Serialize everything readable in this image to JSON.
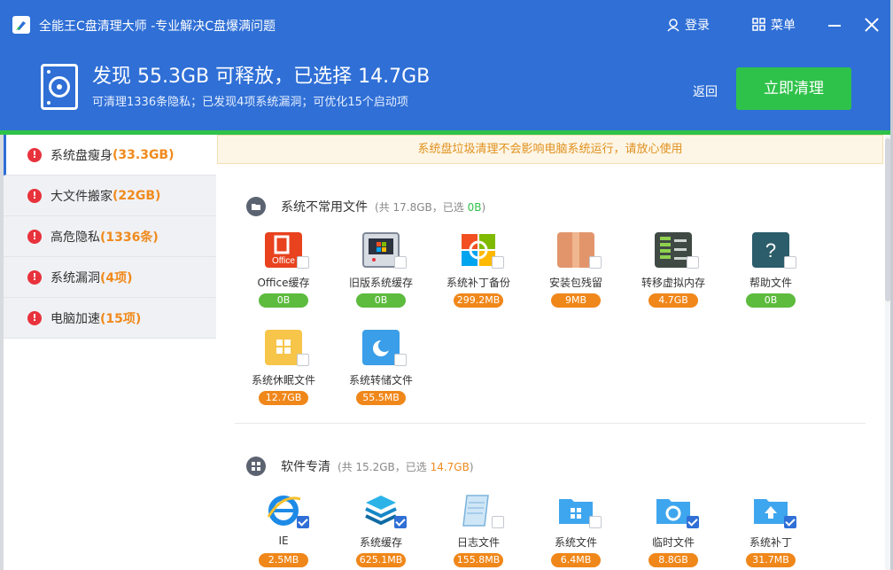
{
  "window": {
    "title": "全能王C盘清理大师 -专业解决C盘爆满问题",
    "login_label": "登录",
    "menu_label": "菜单",
    "icons": {
      "login": "user-icon",
      "menu": "grid-icon",
      "minimize": "minimize-icon",
      "close": "close-icon"
    }
  },
  "summary": {
    "headline": "发现 55.3GB 可释放，已选择 14.7GB",
    "subline": "可清理1336条隐私；已发现4项系统漏洞；可优化15个启动项",
    "back_label": "返回",
    "clean_label": "立即清理"
  },
  "sidebar": {
    "items": [
      {
        "label": "系统盘瘦身",
        "count": "(33.3GB)",
        "active": true
      },
      {
        "label": "大文件搬家",
        "count": "(22GB)",
        "active": false
      },
      {
        "label": "高危隐私",
        "count": "(1336条)",
        "active": false
      },
      {
        "label": "系统漏洞",
        "count": "(4项)",
        "active": false
      },
      {
        "label": "电脑加速",
        "count": "(15项)",
        "active": false
      }
    ]
  },
  "notice": "系统盘垃圾清理不会影响电脑系统运行，请放心使用",
  "sections": [
    {
      "title": "系统不常用文件",
      "meta_prefix": "(共 17.8GB，已选 ",
      "selected": "0B",
      "meta_suffix": ")",
      "items": [
        {
          "label": "Office缓存",
          "size": "0B",
          "size_color": "green",
          "checked": false,
          "icon": "office-icon"
        },
        {
          "label": "旧版系统缓存",
          "size": "0B",
          "size_color": "green",
          "checked": false,
          "icon": "old-system-icon"
        },
        {
          "label": "系统补丁备份",
          "size": "299.2MB",
          "size_color": "orange",
          "checked": false,
          "icon": "windows-patch-icon"
        },
        {
          "label": "安装包残留",
          "size": "9MB",
          "size_color": "orange",
          "checked": false,
          "icon": "package-icon"
        },
        {
          "label": "转移虚拟内存",
          "size": "4.7GB",
          "size_color": "orange",
          "checked": false,
          "icon": "memory-chip-icon"
        },
        {
          "label": "帮助文件",
          "size": "0B",
          "size_color": "green",
          "checked": false,
          "icon": "help-icon"
        },
        {
          "label": "系统休眠文件",
          "size": "12.7GB",
          "size_color": "orange",
          "checked": false,
          "icon": "hibernate-folder-icon"
        },
        {
          "label": "系统转储文件",
          "size": "55.5MB",
          "size_color": "orange",
          "checked": false,
          "icon": "dump-file-icon"
        }
      ]
    },
    {
      "title": "软件专清",
      "meta_prefix": "(共 15.2GB，已选 ",
      "selected": "14.7GB",
      "meta_suffix": ")",
      "items": [
        {
          "label": "IE",
          "size": "2.5MB",
          "size_color": "orange",
          "checked": true,
          "icon": "ie-icon"
        },
        {
          "label": "系统缓存",
          "size": "625.1MB",
          "size_color": "orange",
          "checked": true,
          "icon": "layers-icon"
        },
        {
          "label": "日志文件",
          "size": "155.8MB",
          "size_color": "orange",
          "checked": false,
          "icon": "log-file-icon"
        },
        {
          "label": "系统文件",
          "size": "6.4MB",
          "size_color": "orange",
          "checked": false,
          "icon": "windows-folder-icon"
        },
        {
          "label": "临时文件",
          "size": "8.8GB",
          "size_color": "orange",
          "checked": true,
          "icon": "temp-folder-icon"
        },
        {
          "label": "系统补丁",
          "size": "31.7MB",
          "size_color": "orange",
          "checked": true,
          "icon": "upload-folder-icon"
        }
      ]
    }
  ],
  "colors": {
    "header_blue": "#2f6fd6",
    "accent_green": "#2fc24a",
    "warn_red": "#e8323c",
    "highlight_orange": "#f08a1c"
  }
}
